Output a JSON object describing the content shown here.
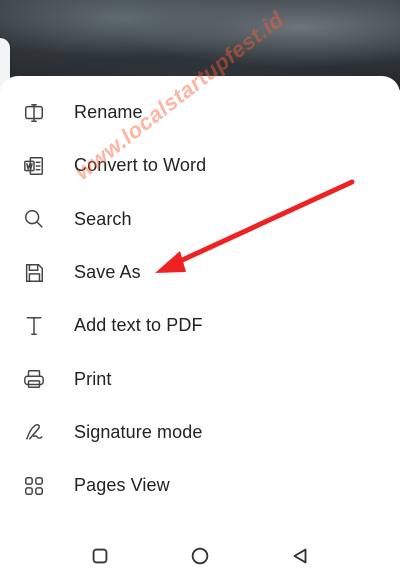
{
  "menu": {
    "items": [
      {
        "label": "Rename",
        "icon": "rename-cursor-icon"
      },
      {
        "label": "Convert to Word",
        "icon": "word-document-icon"
      },
      {
        "label": "Search",
        "icon": "search-icon"
      },
      {
        "label": "Save As",
        "icon": "save-disk-icon"
      },
      {
        "label": "Add text to PDF",
        "icon": "text-tool-icon"
      },
      {
        "label": "Print",
        "icon": "printer-icon"
      },
      {
        "label": "Signature mode",
        "icon": "signature-pen-icon"
      },
      {
        "label": "Pages View",
        "icon": "grid-pages-icon"
      }
    ]
  },
  "watermark": {
    "text": "www.localstartupfest.id"
  },
  "annotation": {
    "arrow_color": "#ee2222",
    "points_to": "Save As"
  },
  "navbar": {
    "buttons": [
      "recents-square-icon",
      "home-circle-icon",
      "back-triangle-icon"
    ]
  }
}
